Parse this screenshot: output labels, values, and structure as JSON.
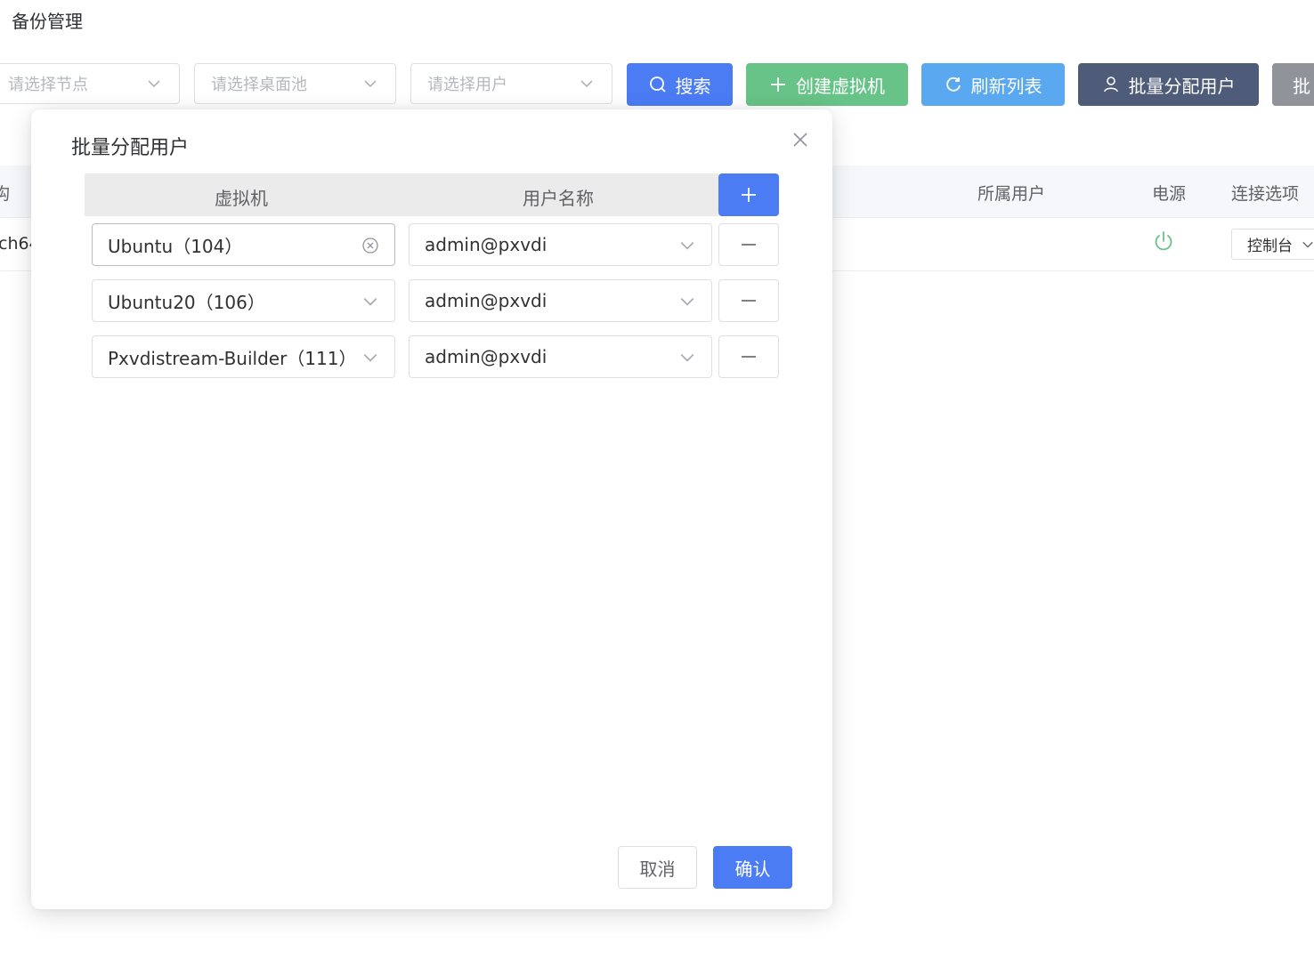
{
  "page": {
    "title": "备份管理"
  },
  "toolbar": {
    "node_select_placeholder": "请选择节点",
    "pool_select_placeholder": "请选择桌面池",
    "user_select_placeholder": "请选择用户",
    "search_label": "搜索",
    "create_vm_label": "创建虚拟机",
    "refresh_label": "刷新列表",
    "batch_assign_label": "批量分配用户",
    "batch_more_label": "批"
  },
  "table": {
    "headers": {
      "arch": "构",
      "owner": "所属用户",
      "power": "电源",
      "connect": "连接选项"
    },
    "row": {
      "arch_value": "ch64",
      "connect_value": "控制台"
    }
  },
  "dialog": {
    "title": "批量分配用户",
    "col_vm": "虚拟机",
    "col_username": "用户名称",
    "rows": [
      {
        "vm": "Ubuntu（104）",
        "user": "admin@pxvdi"
      },
      {
        "vm": "Ubuntu20（106）",
        "user": "admin@pxvdi"
      },
      {
        "vm": "Pxvdistream-Builder（111）",
        "user": "admin@pxvdi"
      }
    ],
    "cancel_label": "取消",
    "confirm_label": "确认"
  },
  "colors": {
    "primary": "#4b7cf4",
    "success": "#67c387",
    "info": "#5aa8f0",
    "dark": "#4e5b79",
    "gray": "#909399",
    "power_on": "#67c387"
  },
  "icons": [
    "chevron-down-icon",
    "search-icon",
    "plus-icon",
    "refresh-icon",
    "user-icon",
    "close-icon",
    "clear-circle-icon",
    "minus-icon",
    "power-icon"
  ]
}
